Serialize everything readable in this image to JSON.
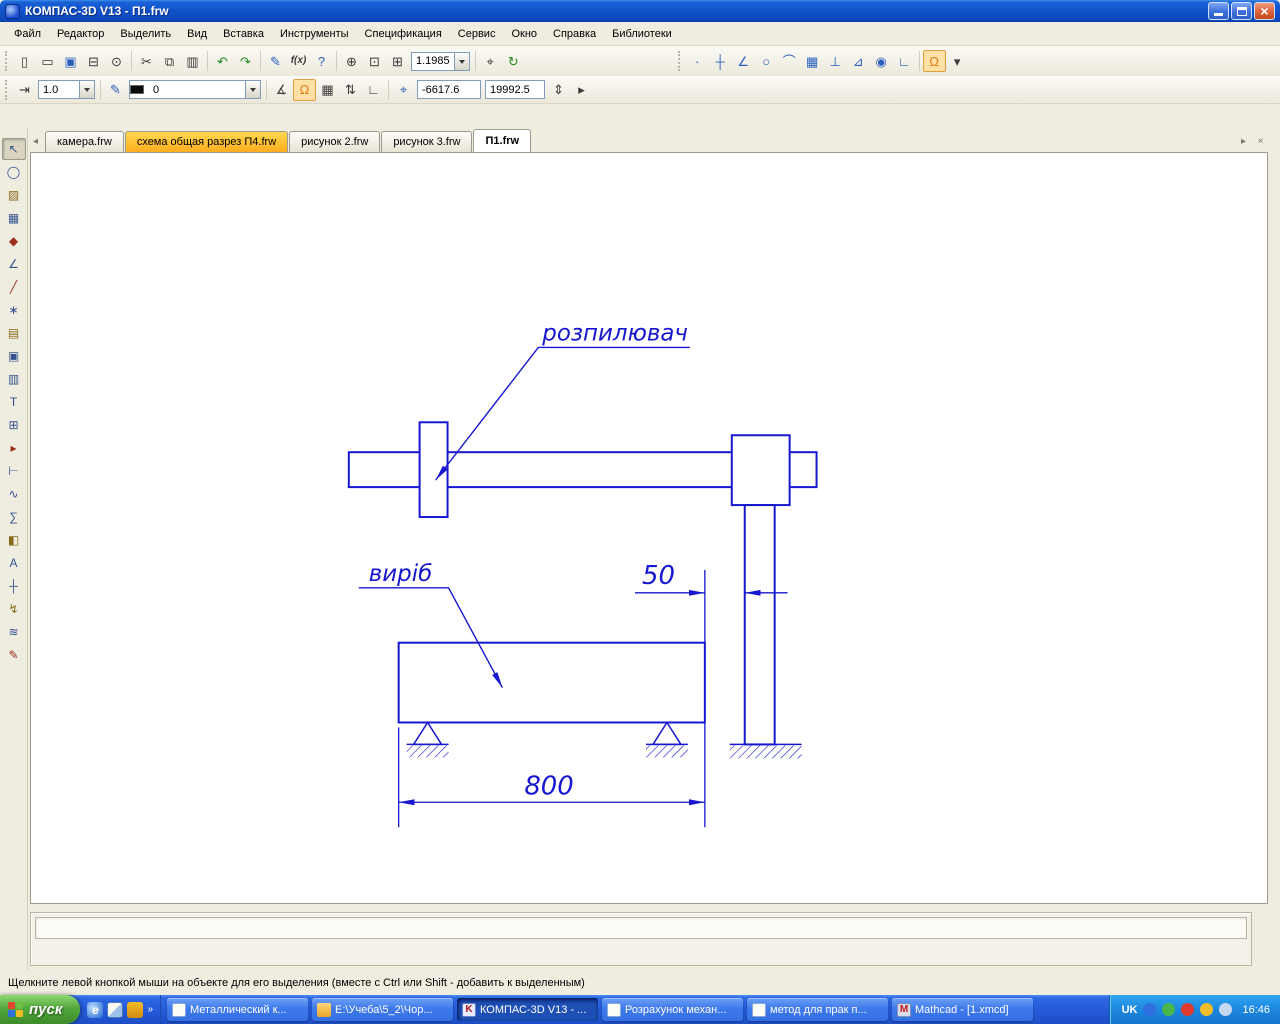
{
  "window": {
    "title": "КОМПАС-3D V13 - П1.frw",
    "controls": {
      "close": "×"
    }
  },
  "menu": {
    "items": [
      "Файл",
      "Редактор",
      "Выделить",
      "Вид",
      "Вставка",
      "Инструменты",
      "Спецификация",
      "Сервис",
      "Окно",
      "Справка",
      "Библиотеки"
    ]
  },
  "toolbar_main": {
    "zoom_value": "1.1985",
    "icons": {
      "new": "▯",
      "open": "▭",
      "save": "▣",
      "print": "⊟",
      "preview": "⊙",
      "cut": "✂",
      "copy": "⧉",
      "paste": "▥",
      "undo": "↶",
      "redo": "↷",
      "copy_props": "✎",
      "fx": "f(x)",
      "what_is": "?",
      "zoom_in": "⊕",
      "zoom_window": "⊡",
      "zoom_auto": "⊞",
      "pan": "⌖",
      "refresh": "↻",
      "overflow": "▾"
    },
    "snap_icons": {
      "point": "∙",
      "cross": "┼",
      "angle": "∠",
      "circle": "○",
      "arc": "⌒",
      "grid": "▦",
      "perp": "⊥",
      "near": "⊿",
      "center": "◉",
      "ortho": "∟",
      "magnet": "Ω",
      "more": "▾"
    }
  },
  "toolbar_params": {
    "step_value": "1.0",
    "layer_value": "0",
    "coord_x": "-6617.6",
    "coord_y": "19992.5",
    "icons": {
      "step": "⇥",
      "pencil": "✎",
      "magnet": "Ω",
      "slope": "∡",
      "grid": "▦",
      "updown": "⇅",
      "corner": "∟",
      "coords": "⌖",
      "spin": "⇕",
      "overflow": "▸"
    }
  },
  "tabs": {
    "scroll_left": "◂",
    "scroll_right": "▸",
    "close": "×",
    "items": [
      {
        "label": "камера.frw"
      },
      {
        "label": "схема общая разрез П4.frw"
      },
      {
        "label": "рисунок 2.frw"
      },
      {
        "label": "рисунок 3.frw"
      },
      {
        "label": "П1.frw"
      }
    ]
  },
  "left_panel": {
    "tools": [
      {
        "glyph": "↖"
      },
      {
        "glyph": "◯"
      },
      {
        "glyph": "▨"
      },
      {
        "glyph": "▦"
      },
      {
        "glyph": "◆"
      },
      {
        "glyph": "∠"
      },
      {
        "glyph": "╱"
      },
      {
        "glyph": "∗"
      },
      {
        "glyph": "▤"
      },
      {
        "glyph": "▣"
      },
      {
        "glyph": "▥"
      },
      {
        "glyph": "T"
      },
      {
        "glyph": "⊞"
      },
      {
        "glyph": "▸"
      },
      {
        "glyph": "⊢"
      },
      {
        "glyph": "∿"
      },
      {
        "glyph": "∑"
      },
      {
        "glyph": "◧"
      },
      {
        "glyph": "A"
      },
      {
        "glyph": "┼"
      },
      {
        "glyph": "↯"
      },
      {
        "glyph": "≋"
      },
      {
        "glyph": "✎"
      }
    ]
  },
  "drawing": {
    "label_sprayer": "розпилювач",
    "label_product": "виріб",
    "dim_gap": "50",
    "dim_length": "800",
    "line_color": "#1717CF"
  },
  "status": {
    "text": "Щелкните левой кнопкой мыши на объекте для его выделения (вместе с Ctrl или Shift - добавить к выделенным)"
  },
  "taskbar": {
    "start_label": "пуск",
    "quick_launch": {
      "ie": "e",
      "chevron": "»"
    },
    "buttons": [
      {
        "label": "Металлический к...",
        "icon": ""
      },
      {
        "label": "E:\\Учеба\\5_2\\Чор...",
        "icon": ""
      },
      {
        "label": "КОМПАС-3D V13 - ...",
        "icon": "K"
      },
      {
        "label": "Розрахунок механ...",
        "icon": ""
      },
      {
        "label": "метод для прак п...",
        "icon": ""
      },
      {
        "label": "Mathcad - [1.xmcd]",
        "icon": "M"
      }
    ],
    "tray": {
      "language": "UK",
      "time": "16:46"
    }
  }
}
